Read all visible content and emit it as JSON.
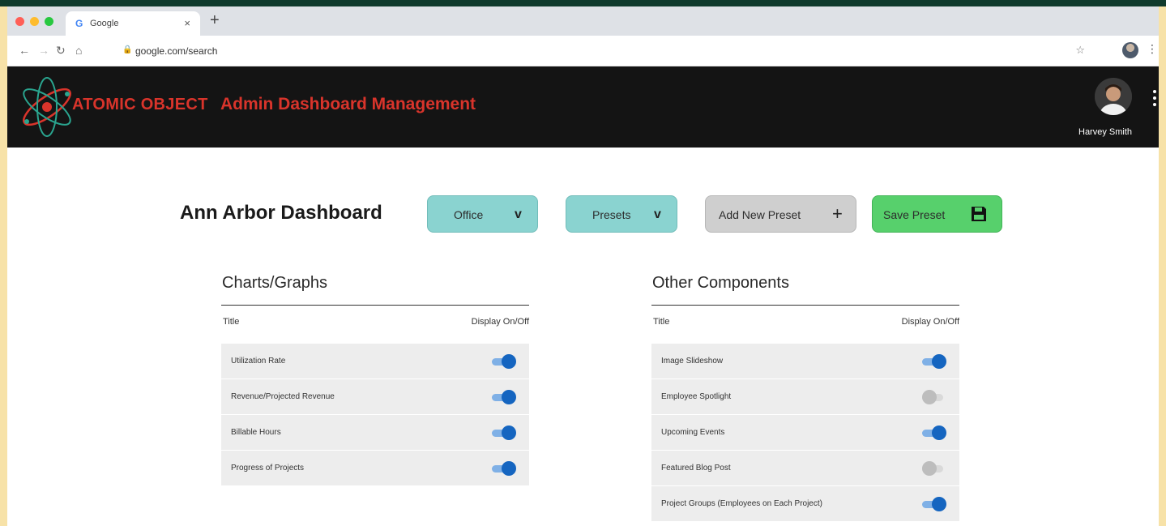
{
  "browser": {
    "tab_title": "Google",
    "tab_favicon": "G",
    "close_glyph": "×",
    "new_tab_glyph": "+",
    "url": "google.com/search"
  },
  "header": {
    "brand": "ATOMIC OBJECT",
    "title": "Admin Dashboard Management",
    "user_name": "Harvey Smith"
  },
  "dashboard": {
    "title": "Ann Arbor Dashboard",
    "office_label": "Office",
    "presets_label": "Presets",
    "add_preset_label": "Add New Preset",
    "save_preset_label": "Save Preset"
  },
  "charts_section": {
    "title": "Charts/Graphs",
    "col_title": "Title",
    "col_display": "Display On/Off",
    "rows": [
      {
        "label": "Utilization Rate",
        "on": true
      },
      {
        "label": "Revenue/Projected Revenue",
        "on": true
      },
      {
        "label": "Billable Hours",
        "on": true
      },
      {
        "label": "Progress of Projects",
        "on": true
      }
    ]
  },
  "other_section": {
    "title": "Other Components",
    "col_title": "Title",
    "col_display": "Display On/Off",
    "rows": [
      {
        "label": "Image Slideshow",
        "on": true
      },
      {
        "label": "Employee Spotlight",
        "on": false
      },
      {
        "label": "Upcoming Events",
        "on": true
      },
      {
        "label": "Featured Blog Post",
        "on": false
      },
      {
        "label": "Project Groups (Employees on Each Project)",
        "on": true
      }
    ]
  },
  "colors": {
    "brand_red": "#d9342b",
    "header_bg": "#141414",
    "teal_button": "#8ad3d0",
    "save_green": "#57d06c",
    "toggle_on": "#1565c0"
  }
}
